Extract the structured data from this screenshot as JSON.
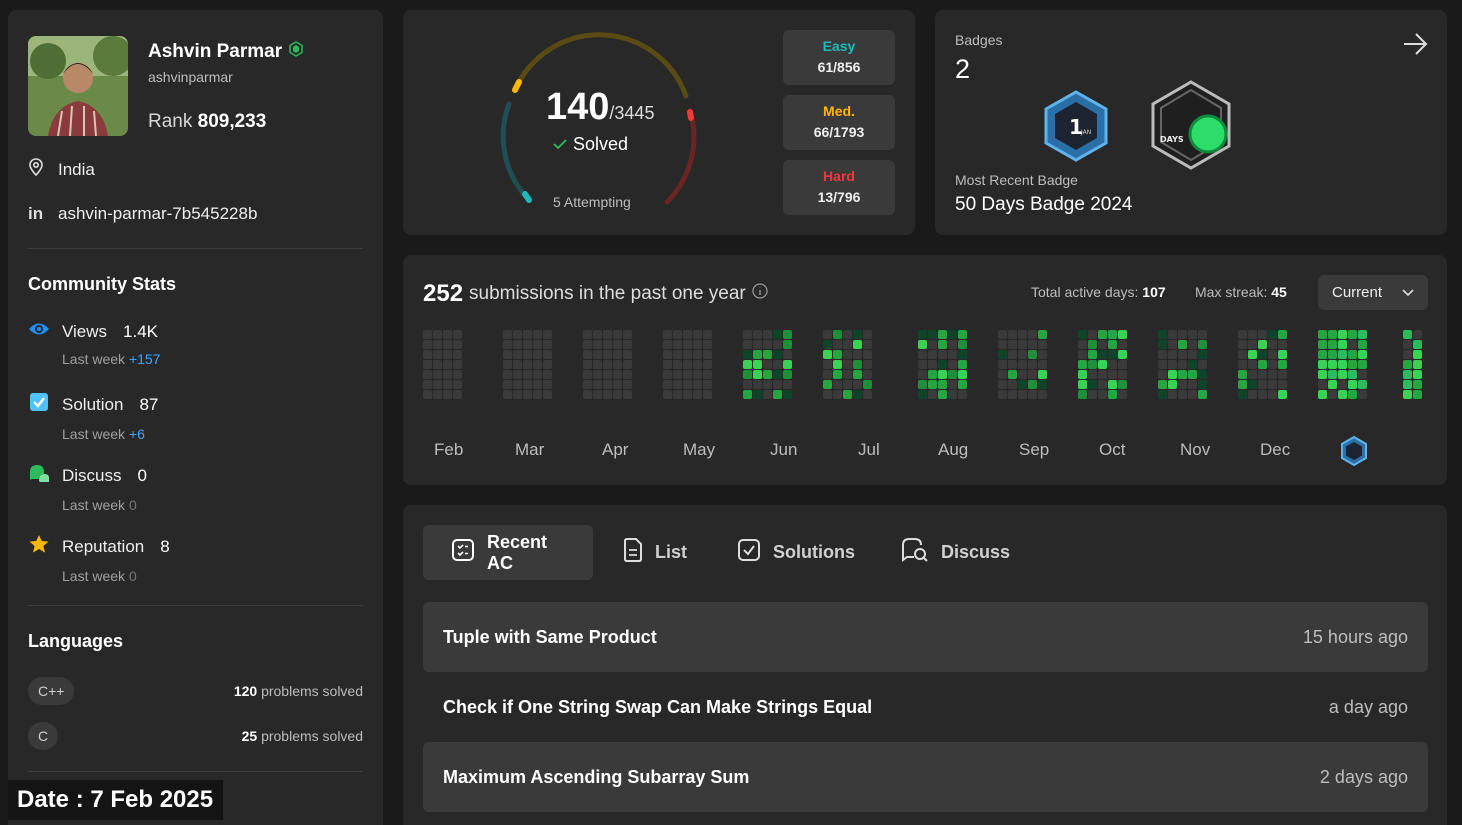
{
  "profile": {
    "name": "Ashvin Parmar",
    "handle": "ashvinparmar",
    "rank_label": "Rank",
    "rank_value": "809,233",
    "location": "India",
    "linkedin": "ashvin-parmar-7b545228b"
  },
  "community": {
    "title": "Community Stats",
    "stats": [
      {
        "label": "Views",
        "value": "1.4K",
        "sub_label": "Last week",
        "sub_value": "+157",
        "icon": "eye-icon",
        "color": "#1e90ff"
      },
      {
        "label": "Solution",
        "value": "87",
        "sub_label": "Last week",
        "sub_value": "+6",
        "icon": "checkbox-icon",
        "color": "#4fc3f7"
      },
      {
        "label": "Discuss",
        "value": "0",
        "sub_label": "Last week",
        "sub_value": "0",
        "icon": "discuss-icon",
        "color": "#2cbb5d"
      },
      {
        "label": "Reputation",
        "value": "8",
        "sub_label": "Last week",
        "sub_value": "0",
        "icon": "star-icon",
        "color": "#ffb800"
      }
    ]
  },
  "languages": {
    "title": "Languages",
    "items": [
      {
        "name": "C++",
        "count": "120",
        "suffix": "problems solved"
      },
      {
        "name": "C",
        "count": "25",
        "suffix": "problems solved"
      }
    ]
  },
  "date_overlay": "Date : 7 Feb 2025",
  "progress": {
    "solved": "140",
    "total": "/3445",
    "solved_label": "Solved",
    "attempting": "5 Attempting",
    "difficulties": [
      {
        "label": "Easy",
        "value": "61/856",
        "color": "#1cbaba"
      },
      {
        "label": "Med.",
        "value": "66/1793",
        "color": "#ffb700"
      },
      {
        "label": "Hard",
        "value": "13/796",
        "color": "#f63737"
      }
    ]
  },
  "badges": {
    "label": "Badges",
    "count": "2",
    "recent_label": "Most Recent Badge",
    "recent_value": "50 Days Badge 2024",
    "badge1_text": "1",
    "badge1_sub": "JAN",
    "badge2_text": "DAYS"
  },
  "calendar": {
    "count": "252",
    "title": "submissions in the past one year",
    "active_days_label": "Total active days:",
    "active_days": "107",
    "max_streak_label": "Max streak:",
    "max_streak": "45",
    "select": "Current",
    "months": [
      "Feb",
      "Mar",
      "Apr",
      "May",
      "Jun",
      "Jul",
      "Aug",
      "Sep",
      "Oct",
      "Nov",
      "Dec"
    ]
  },
  "recent": {
    "tabs": [
      {
        "label": "Recent AC",
        "icon": "recent-ac-icon"
      },
      {
        "label": "List",
        "icon": "list-icon"
      },
      {
        "label": "Solutions",
        "icon": "solutions-icon"
      },
      {
        "label": "Discuss",
        "icon": "discuss-tab-icon"
      }
    ],
    "items": [
      {
        "title": "Tuple with Same Product",
        "time": "15 hours ago"
      },
      {
        "title": "Check if One String Swap Can Make Strings Equal",
        "time": "a day ago"
      },
      {
        "title": "Maximum Ascending Subarray Sum",
        "time": "2 days ago"
      }
    ]
  }
}
